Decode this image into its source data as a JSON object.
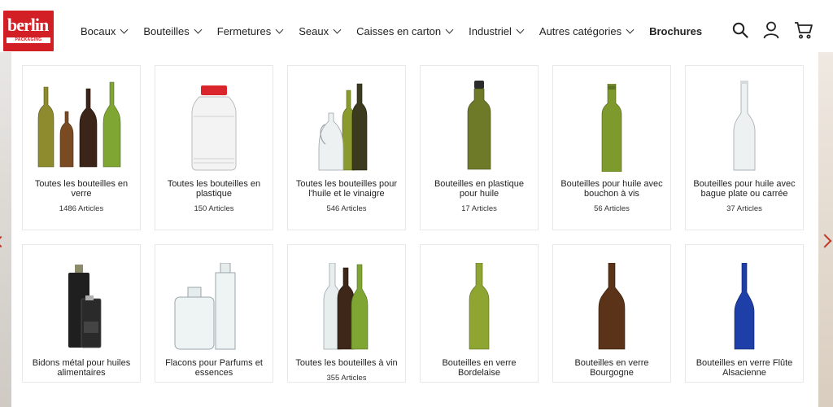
{
  "brand": {
    "name": "berlin",
    "tagline": "PACKAGING"
  },
  "nav": [
    {
      "label": "Bocaux",
      "dropdown": true
    },
    {
      "label": "Bouteilles",
      "dropdown": true
    },
    {
      "label": "Fermetures",
      "dropdown": true
    },
    {
      "label": "Seaux",
      "dropdown": true
    },
    {
      "label": "Caisses en carton",
      "dropdown": true
    },
    {
      "label": "Industriel",
      "dropdown": true
    },
    {
      "label": "Autres catégories",
      "dropdown": true
    },
    {
      "label": "Brochures",
      "dropdown": false
    }
  ],
  "header_icons": [
    "search-icon",
    "account-icon",
    "cart-icon"
  ],
  "categories": [
    {
      "title": "Toutes les bouteilles en verre",
      "count": "1486 Articles"
    },
    {
      "title": "Toutes les bouteilles en plastique",
      "count": "150 Articles"
    },
    {
      "title": "Toutes les bouteilles pour l'huile et le vinaigre",
      "count": "546 Articles"
    },
    {
      "title": "Bouteilles en plastique pour huile",
      "count": "17 Articles"
    },
    {
      "title": "Bouteilles pour huile avec bouchon à vis",
      "count": "56 Articles"
    },
    {
      "title": "Bouteilles pour huile avec bague plate ou carrée",
      "count": "37 Articles"
    },
    {
      "title": "Bidons métal pour huiles alimentaires",
      "count": ""
    },
    {
      "title": "Flacons pour Parfums et essences",
      "count": ""
    },
    {
      "title": "Toutes les bouteilles à vin",
      "count": "355 Articles"
    },
    {
      "title": "Bouteilles en verre Bordelaise",
      "count": ""
    },
    {
      "title": "Bouteilles en verre Bourgogne",
      "count": ""
    },
    {
      "title": "Bouteilles en verre Flûte Alsacienne",
      "count": ""
    }
  ],
  "colors": {
    "brand_red": "#d21f26",
    "olive_glass": "#7b8a2a",
    "amber_glass": "#6a3d1a",
    "blue_glass": "#1f3fa8"
  }
}
